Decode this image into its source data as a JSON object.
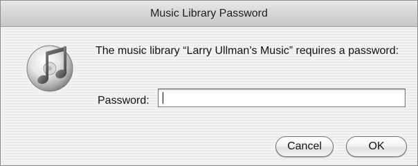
{
  "window": {
    "title": "Music Library Password"
  },
  "dialog": {
    "icon": "itunes-music-note-icon",
    "message": "The music library “Larry Ullman’s Music” requires a password:",
    "password_label": "Password:",
    "password_value": ""
  },
  "buttons": {
    "cancel_label": "Cancel",
    "ok_label": "OK"
  },
  "colors": {
    "window_background": "#ececec",
    "titlebar": "#d4d4d4",
    "text": "#111111"
  }
}
